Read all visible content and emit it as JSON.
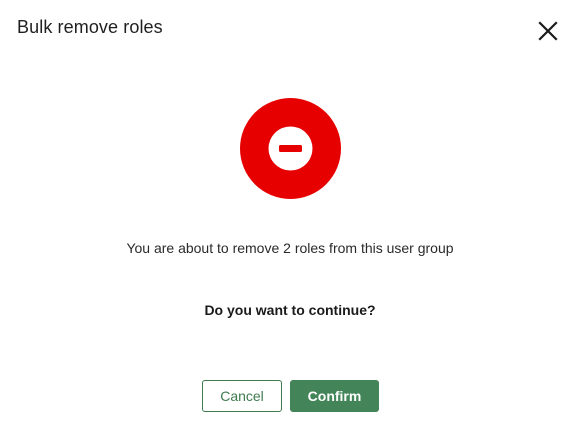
{
  "dialog": {
    "title": "Bulk remove roles",
    "close_icon": "close-icon",
    "status_icon": "remove-circle-icon",
    "accent_color": "#e60000",
    "message": "You are about to remove 2 roles from this user group",
    "question": "Do you want to continue?",
    "cancel_label": "Cancel",
    "confirm_label": "Confirm",
    "button_color": "#438559"
  }
}
